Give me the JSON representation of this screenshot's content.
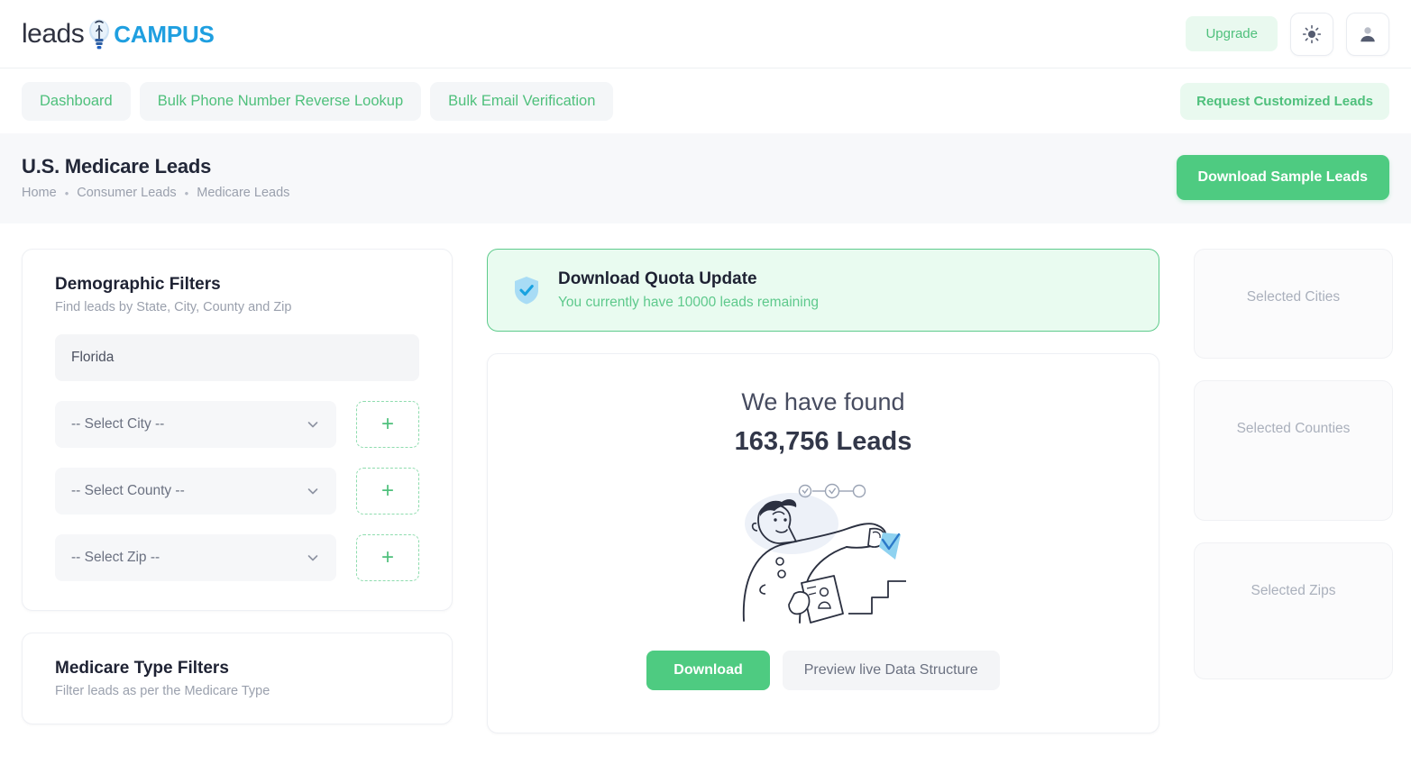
{
  "brand": {
    "name_left": "leads",
    "name_right": "CAMPUS",
    "bulb_icon": "lightbulb-icon"
  },
  "header": {
    "upgrade_label": "Upgrade",
    "theme_icon": "sun-icon",
    "account_icon": "user-avatar-icon"
  },
  "nav": {
    "items": [
      {
        "label": "Dashboard"
      },
      {
        "label": "Bulk Phone Number Reverse Lookup"
      },
      {
        "label": "Bulk Email Verification"
      }
    ],
    "request_label": "Request Customized Leads"
  },
  "page": {
    "title": "U.S. Medicare Leads",
    "breadcrumb": [
      "Home",
      "Consumer Leads",
      "Medicare Leads"
    ],
    "breadcrumb_separator": "•",
    "download_sample_label": "Download Sample Leads"
  },
  "demographic_filters": {
    "title": "Demographic Filters",
    "subtitle": "Find leads by State, City, County and Zip",
    "state_value": "Florida",
    "state_placeholder": "Florida",
    "selects": [
      {
        "label": "-- Select City --",
        "add_icon": "plus-icon"
      },
      {
        "label": "-- Select County --",
        "add_icon": "plus-icon"
      },
      {
        "label": "-- Select Zip --",
        "add_icon": "plus-icon"
      }
    ],
    "chevron_icon": "chevron-down-icon"
  },
  "medicare_filters": {
    "title": "Medicare Type Filters",
    "subtitle": "Filter leads as per the Medicare Type"
  },
  "quota": {
    "icon": "shield-check-icon",
    "title": "Download Quota Update",
    "subtitle": "You currently have 10000 leads remaining"
  },
  "results": {
    "headline": "We have found",
    "count_line": "163,756 Leads",
    "illustration": "person-with-document-illustration",
    "download_label": "Download",
    "preview_label": "Preview live Data Structure"
  },
  "selected_panels": [
    {
      "label": "Selected Cities"
    },
    {
      "label": "Selected Counties"
    },
    {
      "label": "Selected Zips"
    }
  ],
  "colors": {
    "accent_green": "#4ecb81",
    "accent_green_soft": "#e9f9ef",
    "banner_green_bg": "#e9fbf0",
    "banner_green_border": "#5ecb8c",
    "brand_blue": "#1f9fe0",
    "text_dark": "#222738",
    "text_muted": "#9aa0ad",
    "field_bg": "#f4f5f7",
    "band_bg": "#f7f8fa"
  }
}
